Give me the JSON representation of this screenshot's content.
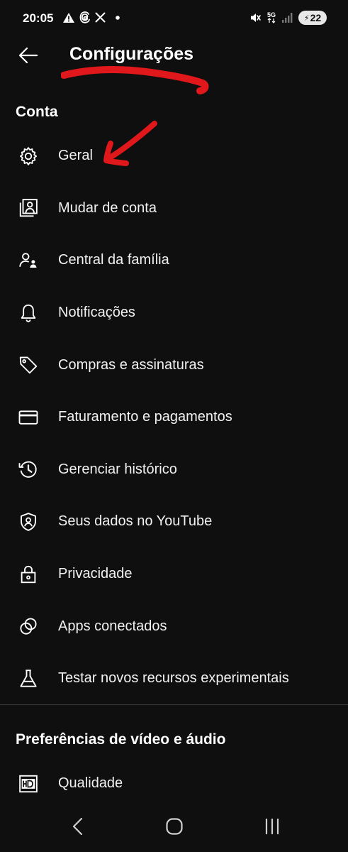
{
  "status_bar": {
    "time": "20:05",
    "battery": "22",
    "network": "5G",
    "icons_left": [
      "warning-icon",
      "threads-icon",
      "x-icon",
      "dot-icon"
    ],
    "icons_right": [
      "mute-icon",
      "5g-icon",
      "signal-icon",
      "battery-icon"
    ]
  },
  "header": {
    "title": "Configurações",
    "back_icon": "arrow-left-icon"
  },
  "sections": [
    {
      "title": "Conta",
      "items": [
        {
          "label": "Geral",
          "icon": "gear-icon"
        },
        {
          "label": "Mudar de conta",
          "icon": "switch-account-icon"
        },
        {
          "label": "Central da família",
          "icon": "family-icon"
        },
        {
          "label": "Notificações",
          "icon": "bell-icon"
        },
        {
          "label": "Compras e assinaturas",
          "icon": "tag-icon"
        },
        {
          "label": "Faturamento e pagamentos",
          "icon": "credit-card-icon"
        },
        {
          "label": "Gerenciar histórico",
          "icon": "history-icon"
        },
        {
          "label": "Seus dados no YouTube",
          "icon": "shield-person-icon"
        },
        {
          "label": "Privacidade",
          "icon": "lock-icon"
        },
        {
          "label": "Apps conectados",
          "icon": "linked-circles-icon"
        },
        {
          "label": "Testar novos recursos experimentais",
          "icon": "flask-icon"
        }
      ]
    },
    {
      "title": "Preferências de vídeo e áudio",
      "items": [
        {
          "label": "Qualidade",
          "icon": "hd-icon"
        }
      ]
    }
  ],
  "nav_bar": {
    "icons": [
      "back-nav-icon",
      "home-nav-icon",
      "recents-nav-icon"
    ]
  },
  "colors": {
    "background": "#0f0f0f",
    "text": "#f1f1f1",
    "annotation": "#e0171b",
    "divider": "#3a3a3a"
  }
}
